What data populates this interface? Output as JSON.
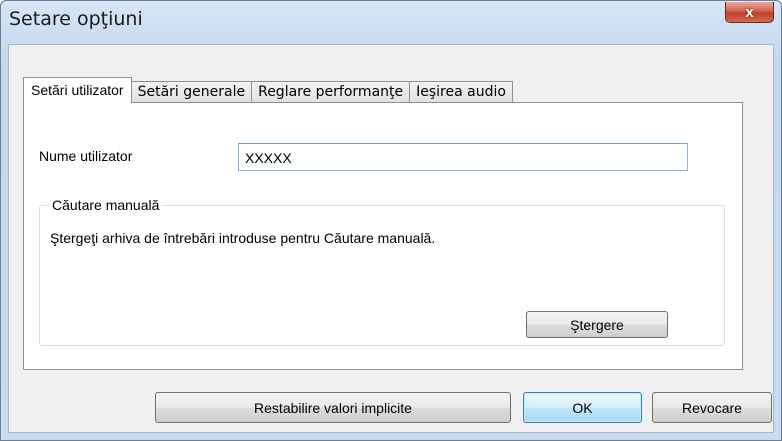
{
  "window": {
    "title": "Setare opţiuni",
    "close_glyph": "x"
  },
  "tabs": [
    {
      "label": "Setări utilizator",
      "active": true
    },
    {
      "label": "Setări generale",
      "active": false
    },
    {
      "label": "Reglare performanţe",
      "active": false
    },
    {
      "label": "Ieşirea audio",
      "active": false
    }
  ],
  "user_settings": {
    "username_label": "Nume utilizator",
    "username_value": "XXXXX",
    "manual_search": {
      "legend": "Căutare manuală",
      "description": "Ştergeţi arhiva de întrebări introduse pentru Căutare manuală.",
      "clear_button": "Ştergere"
    }
  },
  "footer": {
    "restore_button": "Restabilire valori implicite",
    "ok_button": "OK",
    "cancel_button": "Revocare"
  },
  "colors": {
    "title_bar": "#c4d8ee",
    "close_button": "#c2402a",
    "default_button_border": "#3c7fb1"
  }
}
